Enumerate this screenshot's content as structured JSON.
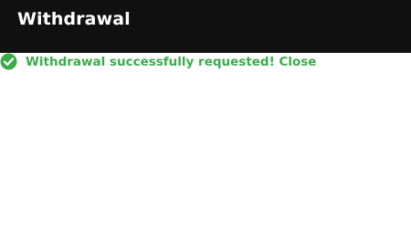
{
  "header": {
    "title": "Withdrawal"
  },
  "alert": {
    "icon": "check-circle-icon",
    "message": "Withdrawal successfully requested!",
    "close_label": "Close"
  },
  "colors": {
    "header_bg": "#111111",
    "header_text": "#ffffff",
    "success": "#3aac4a"
  }
}
